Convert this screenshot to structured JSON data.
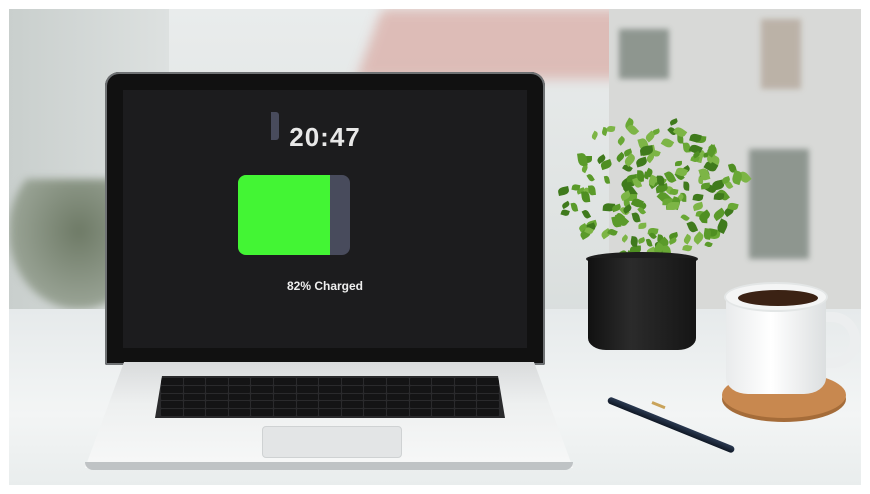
{
  "screen": {
    "clock": "20:47",
    "battery_level": 0.82,
    "charge_label": "82% Charged"
  },
  "colors": {
    "battery_fill": "#43f534",
    "battery_empty": "#484b5c",
    "screen_background": "#1c1c1e"
  },
  "scene_objects": [
    "laptop",
    "potted-plant",
    "coffee-cup",
    "coaster",
    "pen"
  ]
}
